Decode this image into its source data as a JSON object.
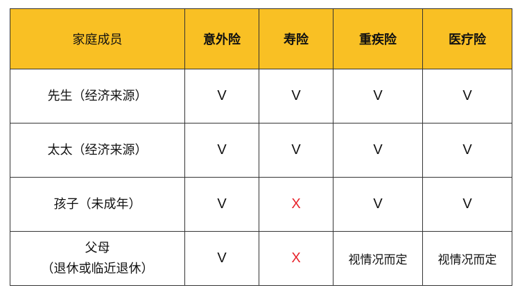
{
  "colors": {
    "header_bg": "#f9c024",
    "border": "#333333",
    "cross": "#e8232b",
    "text": "#111111"
  },
  "table": {
    "headers": [
      "家庭成员",
      "意外险",
      "寿险",
      "重疾险",
      "医疗险"
    ],
    "rows": [
      {
        "member": [
          "先生（经济来源）"
        ],
        "values": [
          "V",
          "V",
          "V",
          "V"
        ],
        "kinds": [
          "check",
          "check",
          "check",
          "check"
        ]
      },
      {
        "member": [
          "太太（经济来源）"
        ],
        "values": [
          "V",
          "V",
          "V",
          "V"
        ],
        "kinds": [
          "check",
          "check",
          "check",
          "check"
        ]
      },
      {
        "member": [
          "孩子（未成年）"
        ],
        "values": [
          "V",
          "X",
          "V",
          "V"
        ],
        "kinds": [
          "check",
          "cross",
          "check",
          "check"
        ]
      },
      {
        "member": [
          "父母",
          "（退休或临近退休）"
        ],
        "values": [
          "V",
          "X",
          "视情况而定",
          "视情况而定"
        ],
        "kinds": [
          "check",
          "cross",
          "note",
          "note"
        ]
      }
    ]
  }
}
